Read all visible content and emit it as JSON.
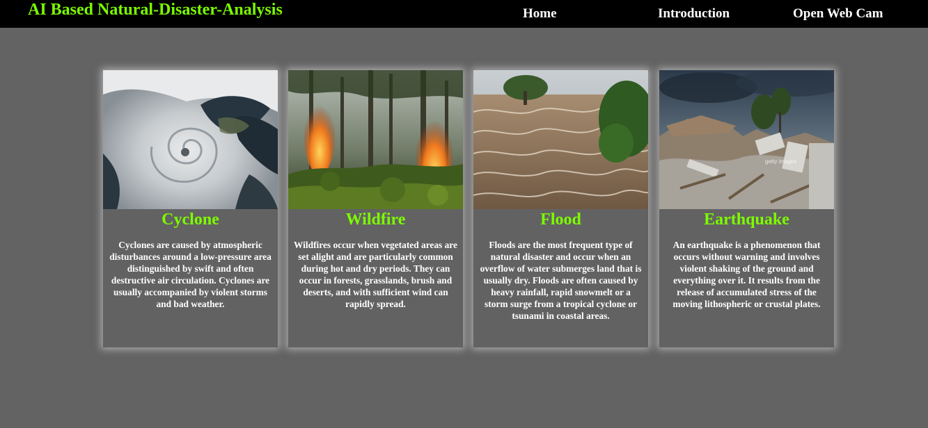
{
  "header": {
    "brand": "AI Based Natural-Disaster-Analysis",
    "nav": {
      "home": "Home",
      "introduction": "Introduction",
      "webcam": "Open Web Cam"
    }
  },
  "colors": {
    "background": "#636363",
    "navbar": "#000000",
    "accent": "#7CFC00",
    "text": "#ffffff"
  },
  "cards": [
    {
      "title": "Cyclone",
      "image": "cyclone-satellite-image",
      "text": "Cyclones are caused by atmospheric disturbances around a low-pressure area distinguished by swift and often destructive air circulation. Cyclones are usually accompanied by violent storms and bad weather."
    },
    {
      "title": "Wildfire",
      "image": "forest-fire-image",
      "text": "Wildfires occur when vegetated areas are set alight and are particularly common during hot and dry periods. They can occur in forests, grasslands, brush and deserts, and with sufficient wind can rapidly spread."
    },
    {
      "title": "Flood",
      "image": "flood-river-image",
      "text": "Floods are the most frequent type of natural disaster and occur when an overflow of water submerges land that is usually dry. Floods are often caused by heavy rainfall, rapid snowmelt or a storm surge from a tropical cyclone or tsunami in coastal areas."
    },
    {
      "title": "Earthquake",
      "image": "earthquake-rubble-image",
      "watermark": "getty images",
      "text": "An earthquake is a phenomenon that occurs without warning and involves violent shaking of the ground and everything over it. It results from the release of accumulated stress of the moving lithospheric or crustal plates."
    }
  ]
}
